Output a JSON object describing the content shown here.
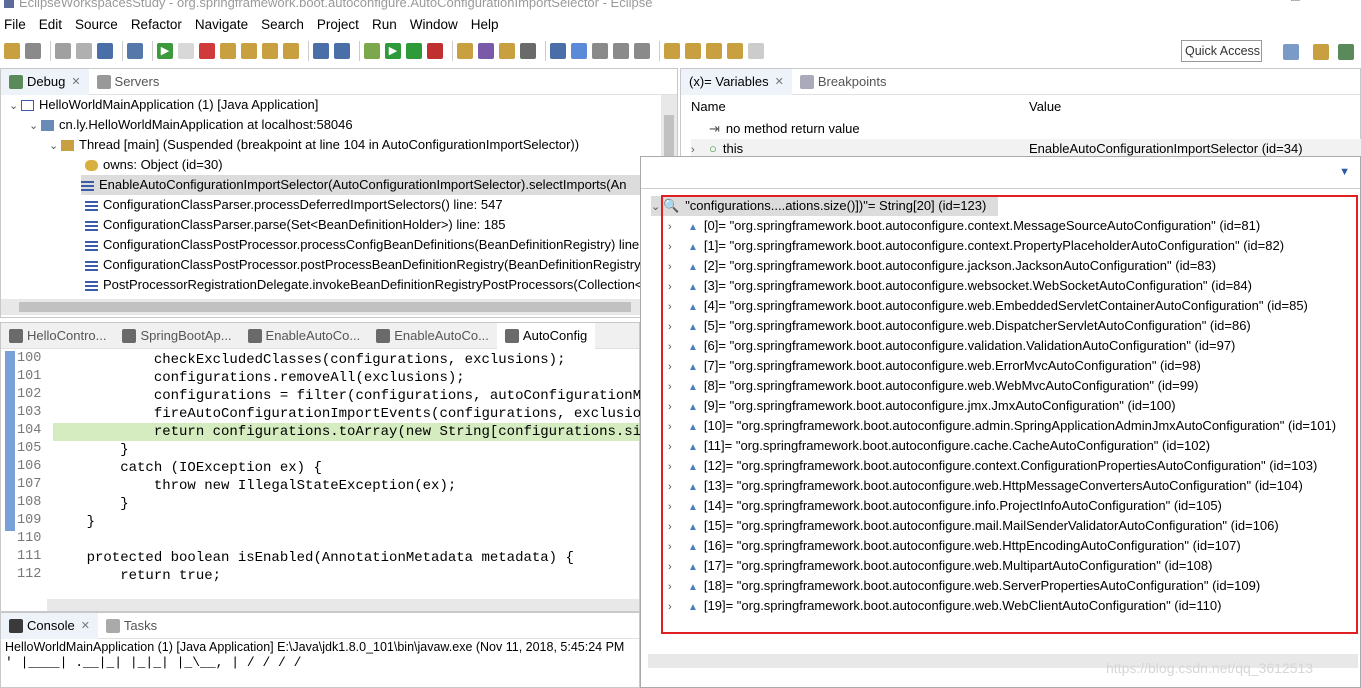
{
  "window": {
    "title": "EclipseWorkspacesStudy - org.springframework.boot.autoconfigure.AutoConfigurationImportSelector - Eclipse"
  },
  "menu": [
    "File",
    "Edit",
    "Source",
    "Refactor",
    "Navigate",
    "Search",
    "Project",
    "Run",
    "Window",
    "Help"
  ],
  "quick_access": "Quick Access",
  "debug_panel": {
    "tabs": [
      "Debug",
      "Servers"
    ],
    "rows": [
      "HelloWorldMainApplication (1) [Java Application]",
      "cn.ly.HelloWorldMainApplication at localhost:58046",
      "Thread [main] (Suspended (breakpoint at line 104 in AutoConfigurationImportSelector))",
      "owns: Object  (id=30)",
      "EnableAutoConfigurationImportSelector(AutoConfigurationImportSelector).selectImports(An",
      "ConfigurationClassParser.processDeferredImportSelectors() line: 547",
      "ConfigurationClassParser.parse(Set<BeanDefinitionHolder>) line: 185",
      "ConfigurationClassPostProcessor.processConfigBeanDefinitions(BeanDefinitionRegistry) line:",
      "ConfigurationClassPostProcessor.postProcessBeanDefinitionRegistry(BeanDefinitionRegistry)",
      "PostProcessorRegistrationDelegate.invokeBeanDefinitionRegistryPostProcessors(Collection<"
    ]
  },
  "variables_panel": {
    "tabs": [
      "(x)= Variables",
      "Breakpoints"
    ],
    "col_name": "Name",
    "col_value": "Value",
    "rows": [
      {
        "name": "no method return value",
        "value": ""
      },
      {
        "name": "this",
        "value": "EnableAutoConfigurationImportSelector  (id=34)"
      }
    ]
  },
  "editor": {
    "tabs": [
      "HelloContro...",
      "SpringBootAp...",
      "EnableAutoCo...",
      "EnableAutoCo...",
      "AutoConfig"
    ],
    "lines": [
      {
        "n": "100",
        "t": "            checkExcludedClasses(configurations, exclusions);"
      },
      {
        "n": "101",
        "t": "            configurations.removeAll(exclusions);"
      },
      {
        "n": "102",
        "t": "            configurations = filter(configurations, autoConfigurationMeta"
      },
      {
        "n": "103",
        "t": "            fireAutoConfigurationImportEvents(configurations, exclusions)"
      },
      {
        "n": "104",
        "t": "            return configurations.toArray(new String[configurations.size()"
      },
      {
        "n": "105",
        "t": "        }"
      },
      {
        "n": "106",
        "t": "        catch (IOException ex) {"
      },
      {
        "n": "107",
        "t": "            throw new IllegalStateException(ex);"
      },
      {
        "n": "108",
        "t": "        }"
      },
      {
        "n": "109",
        "t": "    }"
      },
      {
        "n": "110",
        "t": ""
      },
      {
        "n": "111",
        "t": "    protected boolean isEnabled(AnnotationMetadata metadata) {"
      },
      {
        "n": "112",
        "t": "        return true;"
      }
    ]
  },
  "console": {
    "tabs": [
      "Console",
      "Tasks"
    ],
    "line1": "HelloWorldMainApplication (1) [Java Application] E:\\Java\\jdk1.8.0_101\\bin\\javaw.exe (Nov 11, 2018, 5:45:24 PM",
    "line2": "  '  |____| .__|_| |_|_| |_\\__, | / / / /"
  },
  "popup": {
    "header": "\"configurations....ations.size()])\"= String[20]  (id=123)",
    "items": [
      "[0]= \"org.springframework.boot.autoconfigure.context.MessageSourceAutoConfiguration\" (id=81)",
      "[1]= \"org.springframework.boot.autoconfigure.context.PropertyPlaceholderAutoConfiguration\" (id=82)",
      "[2]= \"org.springframework.boot.autoconfigure.jackson.JacksonAutoConfiguration\" (id=83)",
      "[3]= \"org.springframework.boot.autoconfigure.websocket.WebSocketAutoConfiguration\" (id=84)",
      "[4]= \"org.springframework.boot.autoconfigure.web.EmbeddedServletContainerAutoConfiguration\" (id=85)",
      "[5]= \"org.springframework.boot.autoconfigure.web.DispatcherServletAutoConfiguration\" (id=86)",
      "[6]= \"org.springframework.boot.autoconfigure.validation.ValidationAutoConfiguration\" (id=97)",
      "[7]= \"org.springframework.boot.autoconfigure.web.ErrorMvcAutoConfiguration\" (id=98)",
      "[8]= \"org.springframework.boot.autoconfigure.web.WebMvcAutoConfiguration\" (id=99)",
      "[9]= \"org.springframework.boot.autoconfigure.jmx.JmxAutoConfiguration\" (id=100)",
      "[10]= \"org.springframework.boot.autoconfigure.admin.SpringApplicationAdminJmxAutoConfiguration\" (id=101)",
      "[11]= \"org.springframework.boot.autoconfigure.cache.CacheAutoConfiguration\" (id=102)",
      "[12]= \"org.springframework.boot.autoconfigure.context.ConfigurationPropertiesAutoConfiguration\" (id=103)",
      "[13]= \"org.springframework.boot.autoconfigure.web.HttpMessageConvertersAutoConfiguration\" (id=104)",
      "[14]= \"org.springframework.boot.autoconfigure.info.ProjectInfoAutoConfiguration\" (id=105)",
      "[15]= \"org.springframework.boot.autoconfigure.mail.MailSenderValidatorAutoConfiguration\" (id=106)",
      "[16]= \"org.springframework.boot.autoconfigure.web.HttpEncodingAutoConfiguration\" (id=107)",
      "[17]= \"org.springframework.boot.autoconfigure.web.MultipartAutoConfiguration\" (id=108)",
      "[18]= \"org.springframework.boot.autoconfigure.web.ServerPropertiesAutoConfiguration\" (id=109)",
      "[19]= \"org.springframework.boot.autoconfigure.web.WebClientAutoConfiguration\" (id=110)"
    ]
  },
  "watermark": "https://blog.csdn.net/qq_3612513"
}
